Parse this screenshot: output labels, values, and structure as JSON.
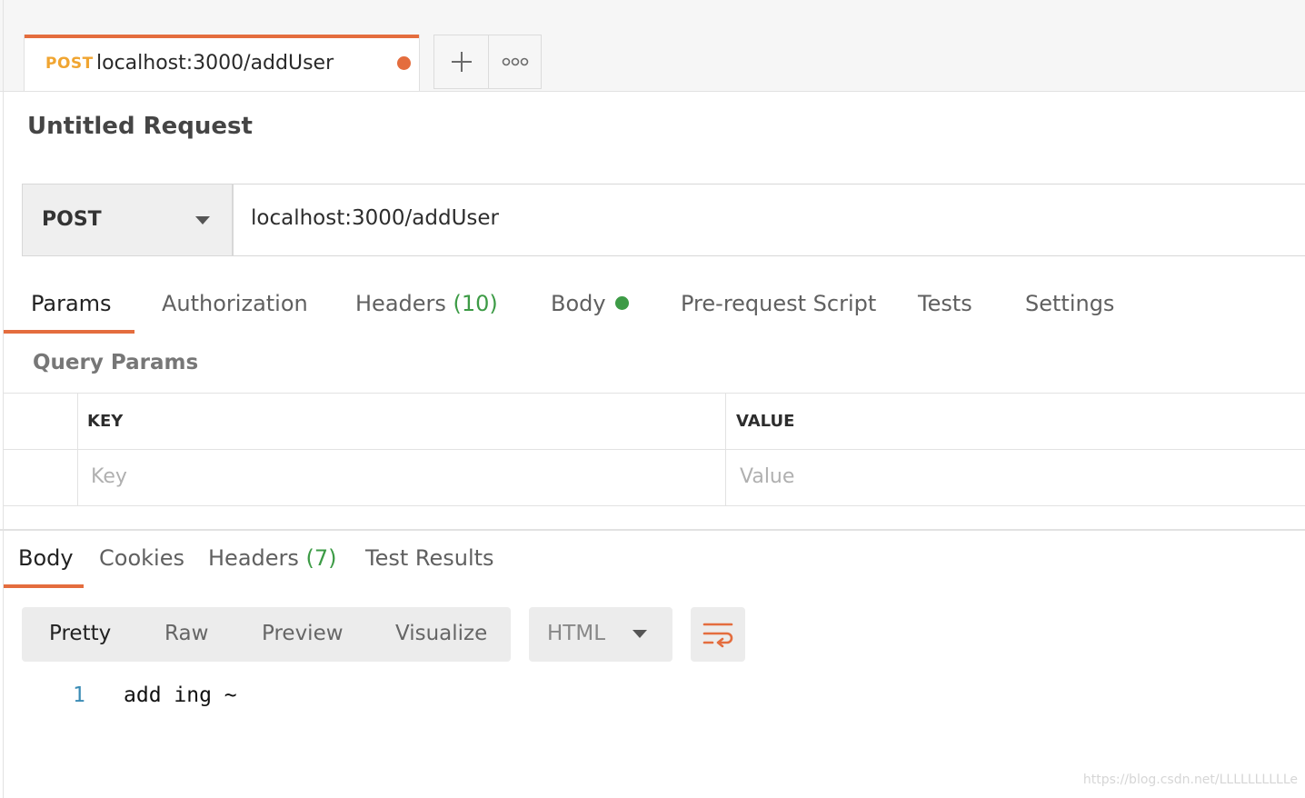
{
  "request_tab": {
    "method": "POST",
    "title": "localhost:3000/addUser",
    "unsaved_indicator_color": "#e46d3e"
  },
  "tab_actions": {
    "new_tab_icon": "plus-icon",
    "more_icon": "ellipsis-icon"
  },
  "request": {
    "name": "Untitled Request",
    "method": "POST",
    "url": "localhost:3000/addUser"
  },
  "request_tabs": {
    "params": "Params",
    "authorization": "Authorization",
    "headers": "Headers",
    "headers_count": "(10)",
    "body": "Body",
    "pre_request": "Pre-request Script",
    "tests": "Tests",
    "settings": "Settings",
    "active": "Params"
  },
  "query_params": {
    "label": "Query Params",
    "columns": [
      "KEY",
      "VALUE"
    ],
    "key_placeholder": "Key",
    "value_placeholder": "Value"
  },
  "response_tabs": {
    "body": "Body",
    "cookies": "Cookies",
    "headers": "Headers",
    "headers_count": "(7)",
    "test_results": "Test Results",
    "active": "Body"
  },
  "response_view": {
    "modes": [
      "Pretty",
      "Raw",
      "Preview",
      "Visualize"
    ],
    "active_mode": "Pretty",
    "language": "HTML",
    "wrap_icon": "wrap-lines-icon"
  },
  "response_body": {
    "lines": [
      {
        "number": "1",
        "text": "add ing ~"
      }
    ]
  },
  "watermark": "https://blog.csdn.net/LLLLLLLLLLe",
  "colors": {
    "accent": "#e46d3e",
    "method_post": "#f0a531",
    "count_green": "#3d9b46",
    "line_number": "#3b8cb5"
  }
}
